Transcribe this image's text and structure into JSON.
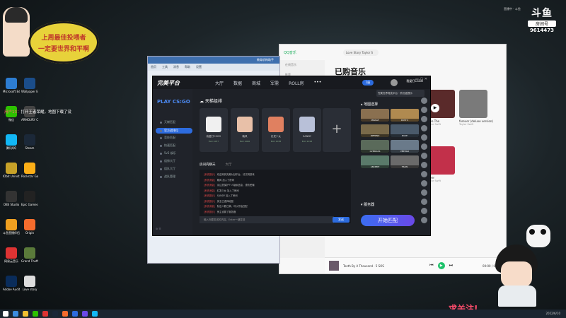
{
  "desktop": {
    "icons": [
      {
        "label": "Microsoft Edge",
        "color": "#2d7dd2"
      },
      {
        "label": "微信",
        "color": "#2dc100"
      },
      {
        "label": "腾讯QQ",
        "color": "#12b7f5"
      },
      {
        "label": "IObit Uninstaller",
        "color": "#c8a228"
      },
      {
        "label": "OBS Studio",
        "color": "#333"
      },
      {
        "label": "斗鱼直播伴侣",
        "color": "#f0a020"
      },
      {
        "label": "网易云音乐",
        "color": "#d33"
      },
      {
        "label": "Adobe Audition",
        "color": "#0a2c5a"
      },
      {
        "label": "Wallpaper Engine",
        "color": "#1b4d8a"
      },
      {
        "label": "ARMOURY CRATE",
        "color": "#444"
      },
      {
        "label": "Steam",
        "color": "#1b2838"
      },
      {
        "label": "Rockstar Games Launcher",
        "color": "#fcaf17"
      },
      {
        "label": "Epic Games Launcher",
        "color": "#222"
      },
      {
        "label": "Origin",
        "color": "#f56c2d"
      },
      {
        "label": "Grand Theft Auto V",
        "color": "#5a7a3a"
      },
      {
        "label": "Love story",
        "color": "#ddd"
      }
    ],
    "bubble": {
      "line1": "上周最佳投喂者",
      "line2": "一定要世界和平啊"
    },
    "danmu": {
      "user": "用户13",
      "text": "打开王者荣耀，地图下载了没"
    },
    "taskbar_clock": "2022/6/10"
  },
  "overlay": {
    "platform": "斗鱼",
    "room_label": "房间号",
    "room_number": "9614473",
    "follow_text": "求关注!",
    "topright_line": "直播中 · 斗鱼"
  },
  "qqmusic": {
    "app_name": "QQ音乐",
    "search_value": "Love Story Taylor S",
    "sidebar": [
      "在线音乐",
      "推荐",
      "乐馆",
      "视频",
      "我的音乐",
      "我喜欢",
      "本地和下载",
      "最近播放",
      "试听列表（上线）"
    ],
    "title": "已购音乐",
    "covers": [
      {
        "caption": "Love The",
        "sub": "Taylor Swift",
        "color": "#5a2a2a"
      },
      {
        "caption": "forever (deluxe version)",
        "sub": "Taylor Swift",
        "color": "#7a7a7a"
      },
      {
        "caption": "Lover",
        "sub": "Taylor Swift",
        "color": "#c2304a"
      }
    ],
    "now_playing": "Teeth By A Thousand · 5 SOS",
    "time": "00:00 / 03:47"
  },
  "blue_window": {
    "title": "教育机构助手",
    "menu": [
      "首页",
      "工具",
      "消息",
      "帮助",
      "设置"
    ]
  },
  "pw": {
    "brand": "完美平台",
    "nav": [
      "大厅",
      "数据",
      "商城",
      "军需",
      "ROLL房",
      "•••"
    ],
    "badge": "1级",
    "username": "我爱打CSGO",
    "tip": "完美世界竞技平台 · 防沉迷提示",
    "game": "PLAY CS:GO",
    "side_items": [
      "天梯匹配",
      "官方战排位",
      "竞技匹配",
      "快速匹配",
      "5v5 娱乐",
      "组排大厅",
      "组队大厅",
      "战队管理"
    ],
    "side_active_index": 1,
    "team_title": "天梯组排",
    "players": [
      {
        "name": "我爱打CSGO",
        "level": "ELO 1057",
        "color": "#f0f0f0"
      },
      {
        "name": "晚风",
        "level": "ELO 1066",
        "color": "#e8c0a8"
      },
      {
        "name": "红发少女",
        "level": "ELO 1038",
        "color": "#e08060"
      },
      {
        "name": "SANDY",
        "level": "ELO 1018",
        "color": "#b8c0d8"
      }
    ],
    "chat_tabs": [
      "房间内聊天",
      "大厅"
    ],
    "chat_lines": [
      {
        "sys": "[系统提示]",
        "text": "欢迎来到完美对战平台，请文明游戏"
      },
      {
        "sys": "[系统消息]",
        "text": "晚风 加入了房间"
      },
      {
        "sys": "[系统消息]",
        "text": "请注意保护个人隐私信息，谨防受骗"
      },
      {
        "sys": "[系统消息]",
        "text": "红发少女 加入了房间"
      },
      {
        "sys": "[系统提示]",
        "text": "SANDY 加入了房间"
      },
      {
        "sys": "[系统提示]",
        "text": "房主已选择地图"
      },
      {
        "sys": "[系统消息]",
        "text": "队伍人数已满，可以开始匹配"
      },
      {
        "sys": "[系统提示]",
        "text": "房主设置了服务器"
      }
    ],
    "chat_placeholder": "输入你要发送的内容，Enter一键发送",
    "send_label": "发送",
    "map_header": "地图选择",
    "maps": [
      {
        "name": "MIRAGE",
        "color": "#8a7050"
      },
      {
        "name": "DUST II",
        "color": "#b08a50"
      },
      {
        "name": "INFERNO",
        "color": "#7a6a4a"
      },
      {
        "name": "NUKE",
        "color": "#4a5a6a"
      },
      {
        "name": "OVERPASS",
        "color": "#5a6a5a"
      },
      {
        "name": "VERTIGO",
        "color": "#6a7a8a"
      },
      {
        "name": "ANCIENT",
        "color": "#5a7a6a"
      },
      {
        "name": "TRAIN",
        "color": "#6a6a6a"
      }
    ],
    "server_label": "服务器",
    "start_label": "开始匹配"
  }
}
